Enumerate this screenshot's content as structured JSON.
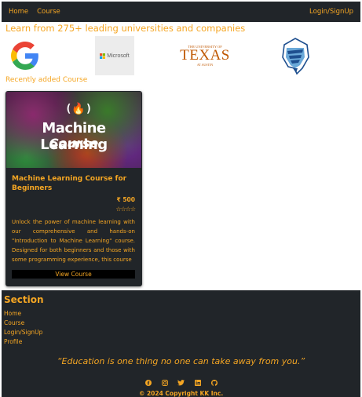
{
  "nav": {
    "links": [
      "Home",
      "Course"
    ],
    "login": "Login/SignUp"
  },
  "partners": {
    "heading": "Learn from 275+ leading universities and companies",
    "logos": [
      "google-logo",
      "microsoft-logo",
      "texas-logo",
      "team-logo"
    ],
    "microsoft_label": "Microsoft",
    "texas_top": "THE UNIVERSITY OF",
    "texas_main": "TEXAS",
    "texas_sub": "AT AUSTIN"
  },
  "recent": {
    "heading": "Recently added Course"
  },
  "course": {
    "image_title": "Machine Learning",
    "image_subtitle": "Course",
    "title": "Machine Learning Course for Beginners",
    "price": "₹ 500",
    "rating": 0,
    "stars": "☆☆☆☆",
    "description": "Unlock the power of machine learning with our comprehensive and hands-on \"Introduction to Machine Learning\" course. Designed for both beginners and those with some programming experience, this course",
    "button": "View Course"
  },
  "footer": {
    "heading": "Section",
    "links": [
      "Home",
      "Course",
      "Login/SignUp",
      "Profile"
    ],
    "quote": "“Education is one thing no one can take away from you.”",
    "socials": [
      "facebook-icon",
      "instagram-icon",
      "twitter-icon",
      "linkedin-icon",
      "github-icon"
    ],
    "copyright": "© 2024 Copyright KK Inc."
  },
  "colors": {
    "accent": "#f5a623",
    "dark": "#212529",
    "background": "#ffffff"
  }
}
